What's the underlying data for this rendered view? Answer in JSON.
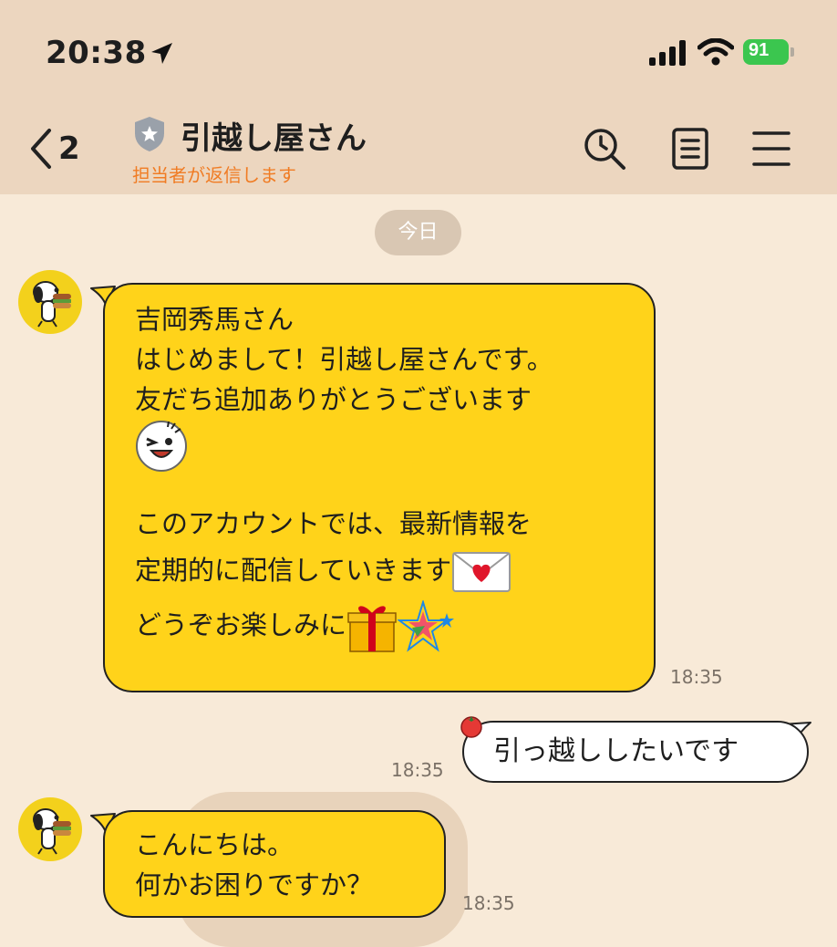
{
  "status_bar": {
    "time": "20:38",
    "battery": "91",
    "battery_color": "#3bc64f"
  },
  "header": {
    "back_count": "2",
    "title": "引越し屋さん",
    "subtitle": "担当者が返信します",
    "icons": [
      "search-icon",
      "notes-icon",
      "menu-icon"
    ]
  },
  "chat": {
    "date_label": "今日",
    "messages": [
      {
        "from": "account",
        "lines": [
          "吉岡秀馬さん",
          "はじめまして！引越し屋さんです。",
          "友だち追加ありがとうございます",
          "",
          "",
          "このアカウントでは、最新情報を",
          "定期的に配信していきます",
          "どうぞお楽しみに"
        ],
        "time": "18:35",
        "emojis": [
          "winking-face-emoji",
          "love-letter-emoji",
          "gift-emoji",
          "stars-emoji"
        ]
      },
      {
        "from": "me",
        "text": "引っ越ししたいです",
        "time": "18:35"
      },
      {
        "from": "account",
        "lines": [
          "こんにちは。",
          "何かお困りですか？"
        ],
        "time": "18:35"
      }
    ]
  },
  "colors": {
    "header_bg": "#ecd6bf",
    "chat_bg": "#f8ead8",
    "account_bubble": "#ffd31a",
    "user_bubble": "#ffffff",
    "subtitle": "#f07c24"
  }
}
